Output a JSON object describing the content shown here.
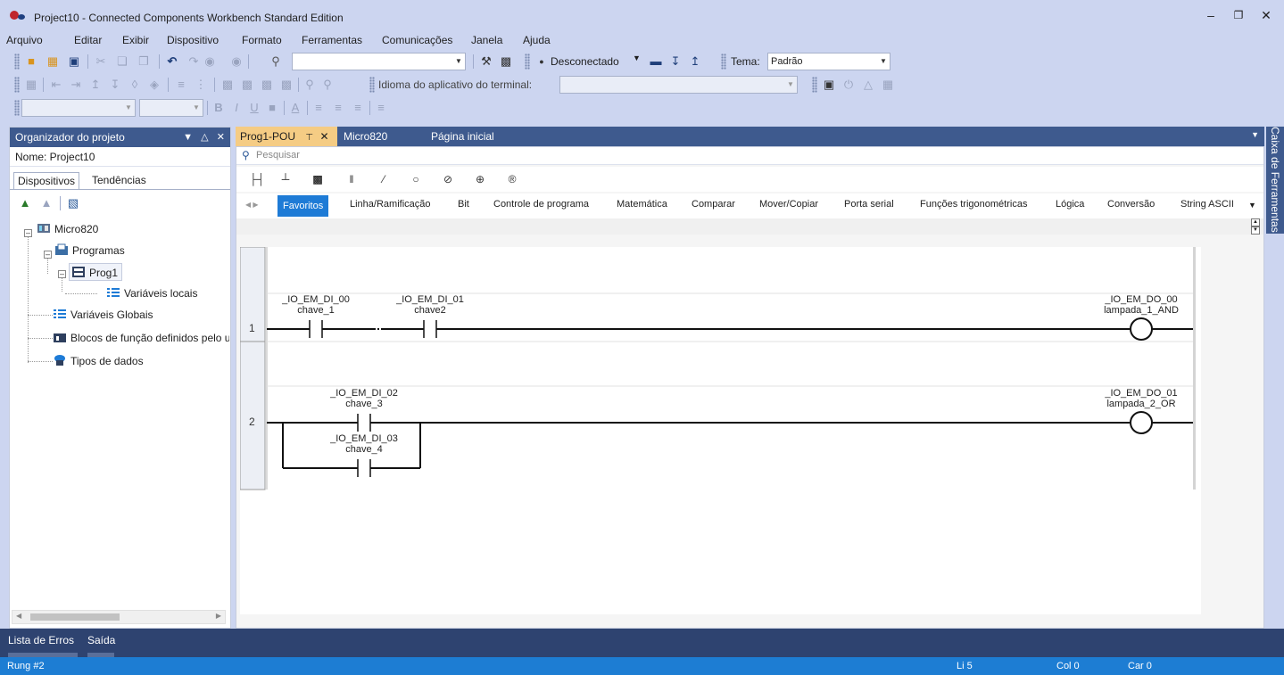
{
  "window": {
    "title": "Project10 - Connected Components Workbench Standard Edition",
    "controls": [
      "minimize",
      "restore",
      "close"
    ]
  },
  "menu": [
    "Arquivo",
    "Editar",
    "Exibir",
    "Dispositivo",
    "Formato",
    "Ferramentas",
    "Comunicações",
    "Janela",
    "Ajuda"
  ],
  "toolbar1": {
    "search_combo": "",
    "connection_status": "Desconectado",
    "theme_label": "Tema:",
    "theme_value": "Padrão"
  },
  "toolbar2": {
    "terminal_language_label": "Idioma do aplicativo do terminal:",
    "terminal_language_value": ""
  },
  "toolbar3": {
    "font_combo": "",
    "size_combo": "",
    "bold": "B",
    "italic": "I",
    "underline": "U",
    "font_color": "A"
  },
  "project_organizer": {
    "title": "Organizador do projeto",
    "name_label": "Nome: Project10",
    "tabs": [
      "Dispositivos",
      "Tendências"
    ],
    "tree": {
      "controller": "Micro820",
      "programs": "Programas",
      "program": "Prog1",
      "local_vars": "Variáveis locais",
      "global_vars": "Variáveis Globais",
      "fb_defined": "Blocos de função definidos pelo usuário",
      "data_types": "Tipos de dados"
    }
  },
  "doc_tabs": [
    {
      "label": "Prog1-POU",
      "active": true
    },
    {
      "label": "Micro820",
      "active": false
    },
    {
      "label": "Página inicial",
      "active": false
    }
  ],
  "editor": {
    "search_placeholder": "Pesquisar",
    "categories": [
      "Favoritos",
      "Linha/Ramificação",
      "Bit",
      "Controle de programa",
      "Matemática",
      "Comparar",
      "Mover/Copiar",
      "Porta serial",
      "Funções trigonométricas",
      "Lógica",
      "Conversão",
      "String ASCII"
    ],
    "active_category": "Favoritos",
    "rungs": [
      {
        "number": "1",
        "contacts": [
          {
            "address": "_IO_EM_DI_00",
            "alias": "chave_1"
          },
          {
            "address": "_IO_EM_DI_01",
            "alias": "chave2"
          }
        ],
        "coil": {
          "address": "_IO_EM_DO_00",
          "alias": "lampada_1_AND"
        }
      },
      {
        "number": "2",
        "contacts": [
          {
            "address": "_IO_EM_DI_02",
            "alias": "chave_3"
          },
          {
            "address": "_IO_EM_DI_03",
            "alias": "chave_4"
          }
        ],
        "coil": {
          "address": "_IO_EM_DO_01",
          "alias": "lampada_2_OR"
        }
      }
    ]
  },
  "toolbox_label": "Caixa de Ferramentas",
  "bottom_tabs": [
    "Lista de Erros",
    "Saída"
  ],
  "status": {
    "rung": "Rung #2",
    "line": "Li 5",
    "col": "Col 0",
    "car": "Car 0"
  },
  "colors": {
    "chrome": "#ccd5f0",
    "panel_header": "#3e5a8e",
    "active_tab": "#f5cc84",
    "accent": "#1e7bd6",
    "statusbar": "#1d7dd3"
  }
}
